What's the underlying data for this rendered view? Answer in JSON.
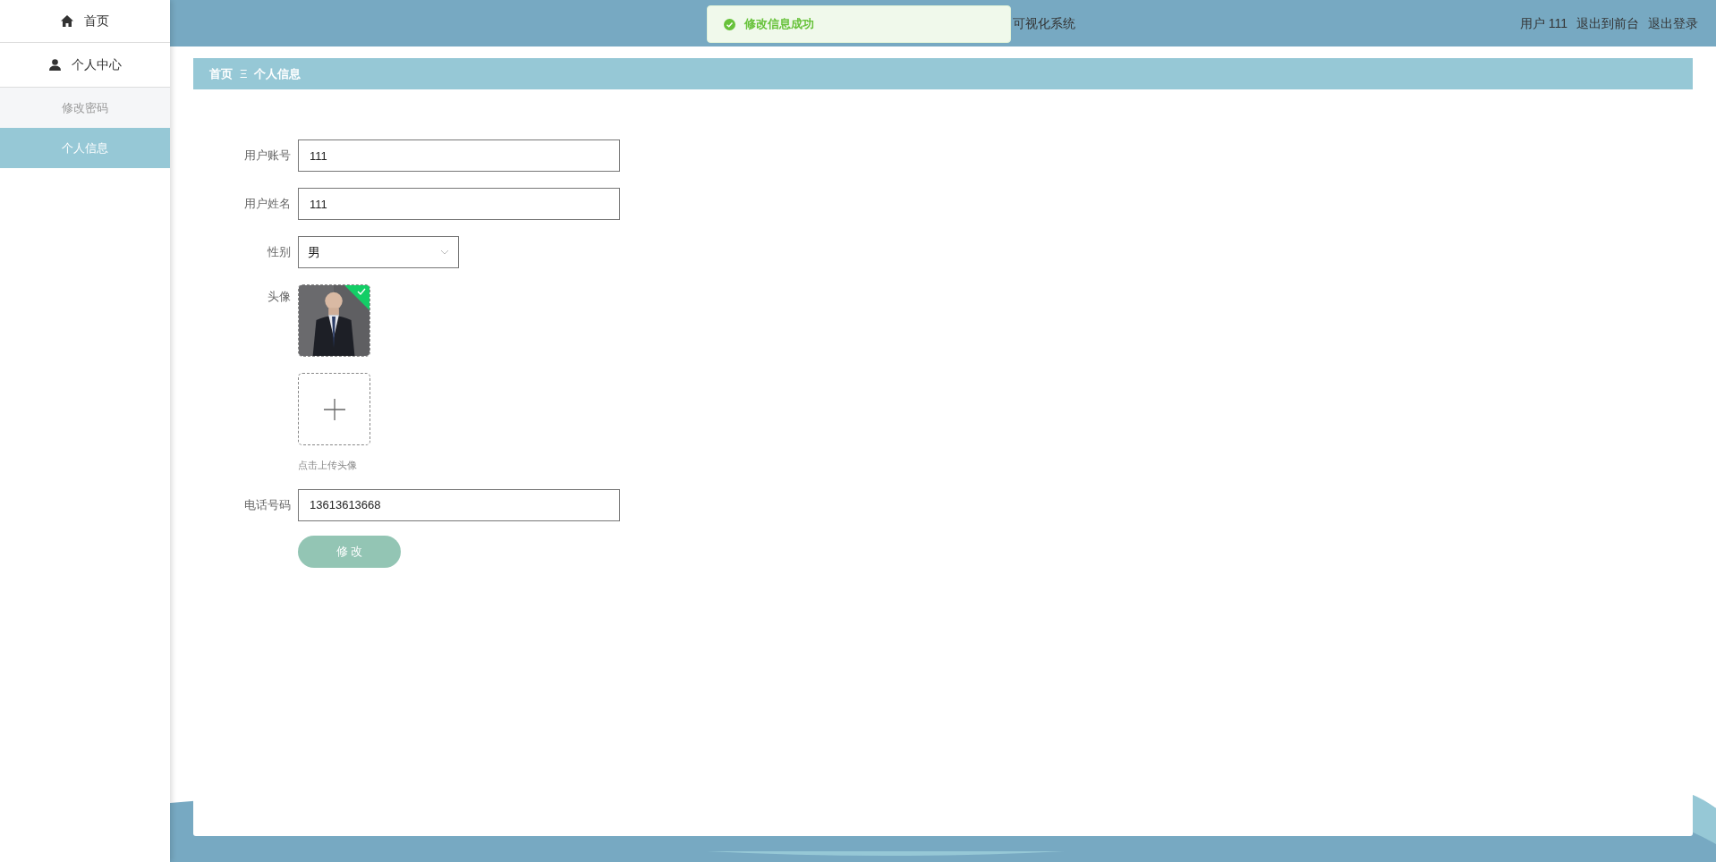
{
  "sidebar": {
    "items": [
      {
        "label": "首页",
        "kind": "home",
        "selected": false
      },
      {
        "label": "个人中心",
        "kind": "user",
        "selected": false,
        "children": [
          {
            "label": "修改密码",
            "selected": false
          },
          {
            "label": "个人信息",
            "selected": true
          }
        ]
      }
    ]
  },
  "header": {
    "title": "可视化系统",
    "user": "用户 111",
    "links": [
      "退出到前台",
      "退出登录"
    ]
  },
  "toast": {
    "kind": "success",
    "message": "修改信息成功"
  },
  "breadcrumb": {
    "items": [
      "首页",
      "个人信息"
    ],
    "separator": "Ξ"
  },
  "form": {
    "fields": [
      {
        "kind": "text",
        "label": "用户账号",
        "value": "111"
      },
      {
        "kind": "text",
        "label": "用户姓名",
        "value": "111"
      },
      {
        "kind": "select",
        "label": "性别",
        "value": "男"
      },
      {
        "kind": "avatar",
        "label": "头像",
        "hint": "点击上传头像"
      },
      {
        "kind": "text",
        "label": "电话号码",
        "value": "13613613668"
      }
    ],
    "submit": "修 改"
  }
}
